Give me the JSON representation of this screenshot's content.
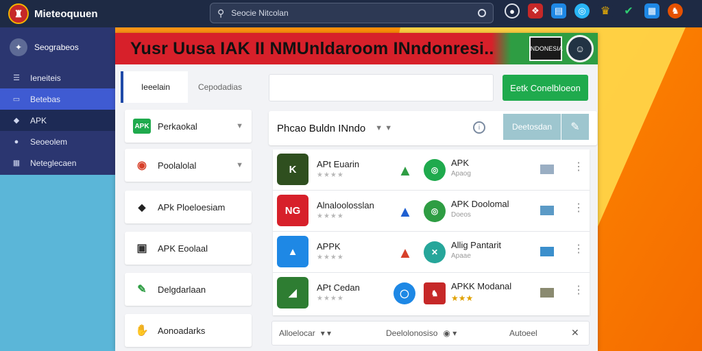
{
  "topbar": {
    "app_title": "Mieteoquuen",
    "search_placeholder": "Seocie Nitcolan",
    "icons": [
      "camera-icon",
      "bookmark-icon",
      "download-icon",
      "globe-icon",
      "crown-icon",
      "android-icon",
      "image-icon",
      "shield-icon"
    ]
  },
  "sidebar": {
    "header": "Seograbeos",
    "items": [
      {
        "label": "Ieneiteis",
        "icon": "list-icon"
      },
      {
        "label": "Betebas",
        "icon": "folder-icon"
      },
      {
        "label": "APK",
        "icon": "apk-icon"
      },
      {
        "label": "Seoeolem",
        "icon": "user-icon"
      },
      {
        "label": "Neteglecaen",
        "icon": "grid-icon"
      }
    ]
  },
  "banner": {
    "title": "Yusr Uusa IAK II NMUnldaroom INndonresi..",
    "flag_label": "INDONESIA"
  },
  "left": {
    "tabs": [
      "Ieeelain",
      "Cepodadias"
    ],
    "categories": [
      {
        "label": "Perkaokal",
        "icon_text": "APK",
        "icon_color": "#1faa4d"
      },
      {
        "label": "Poolalolal",
        "icon_text": "◉",
        "icon_color": "#d7402a"
      },
      {
        "label": "APk Ploeloesiam",
        "icon_text": "◆",
        "icon_color": "#222222"
      },
      {
        "label": "APK Eoolaal",
        "icon_text": "▣",
        "icon_color": "#333333"
      },
      {
        "label": "Delgdarlaan",
        "icon_text": "✎",
        "icon_color": "#2e9d43"
      },
      {
        "label": "Aonoadarks",
        "icon_text": "✋",
        "icon_color": "#555555"
      }
    ]
  },
  "right": {
    "primary_button": "Eetk Conelbloeon",
    "filter_title": "Phcao Buldn INndo",
    "filter_button": "Deetosdan",
    "apps": [
      {
        "name": "APt Euarin",
        "stars": "★★★★",
        "icon_color": "#2f4f1f",
        "icon_text": "K",
        "name2": "APK",
        "sub2": "Apaog",
        "ico2_color": "#2e9d43",
        "ico3_color": "#1faa4d",
        "swatch": "#9aaec3"
      },
      {
        "name": "Alnaloolosslan",
        "stars": "★★★★",
        "icon_color": "#d7202a",
        "icon_text": "NG",
        "name2": "APK Doolomal",
        "sub2": "Doeos",
        "ico2_color": "#1f5fd1",
        "ico3_color": "#2e9d43",
        "swatch": "#5b9ac6"
      },
      {
        "name": "APPK",
        "stars": "★★★★",
        "icon_color": "#1e88e5",
        "icon_text": "▲",
        "name2": "Allig Pantarit",
        "sub2": "Apaae",
        "ico2_color": "#d7402a",
        "ico3_color": "#26a69a",
        "swatch": "#3b8fcc"
      },
      {
        "name": "APt Cedan",
        "stars": "★★★★",
        "icon_color": "#2e7d32",
        "icon_text": "◢",
        "name2": "APKK Modanal",
        "sub2": "★★★",
        "ico2_color": "#1e88e5",
        "ico3_color": "#c62828",
        "swatch": "#8a8a70"
      }
    ],
    "bottom_bar": {
      "left": "Alloelocar",
      "middle": "Deelolonosiso",
      "right": "Autoeel"
    }
  }
}
